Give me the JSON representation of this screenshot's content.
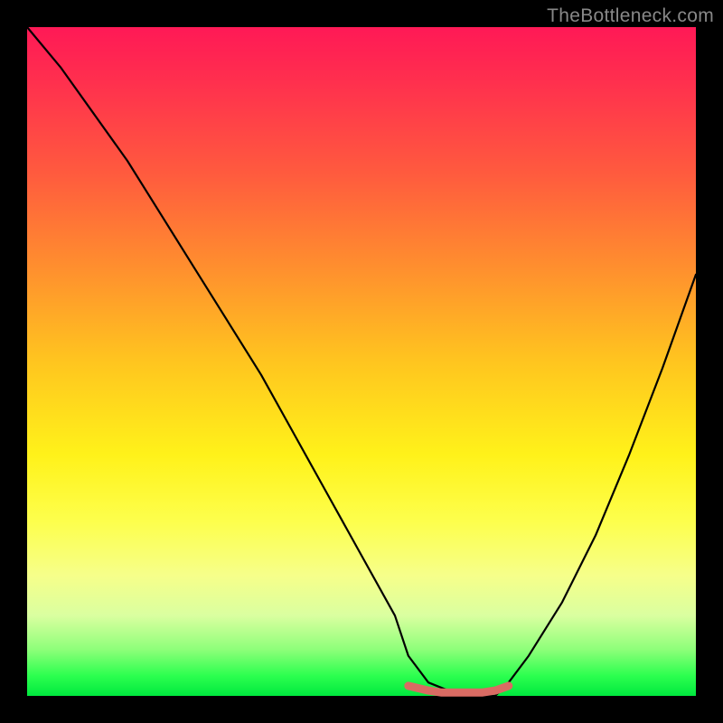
{
  "watermark": "TheBottleneck.com",
  "chart_data": {
    "type": "line",
    "title": "",
    "xlabel": "",
    "ylabel": "",
    "xlim": [
      0,
      100
    ],
    "ylim": [
      0,
      100
    ],
    "grid": false,
    "legend": false,
    "series": [
      {
        "name": "bottleneck-curve",
        "color": "#000000",
        "x": [
          0,
          5,
          10,
          15,
          20,
          25,
          30,
          35,
          40,
          45,
          50,
          55,
          57,
          60,
          65,
          70,
          72,
          75,
          80,
          85,
          90,
          95,
          100
        ],
        "y": [
          100,
          94,
          87,
          80,
          72,
          64,
          56,
          48,
          39,
          30,
          21,
          12,
          6,
          2,
          0,
          0,
          2,
          6,
          14,
          24,
          36,
          49,
          63
        ]
      },
      {
        "name": "optimal-range-marker",
        "color": "#d96b63",
        "x": [
          57,
          60,
          62,
          65,
          68,
          70,
          72
        ],
        "y": [
          1.5,
          0.8,
          0.5,
          0.5,
          0.5,
          0.8,
          1.5
        ]
      }
    ],
    "background_gradient": {
      "stops": [
        {
          "pos": 0.0,
          "color": "#ff1956"
        },
        {
          "pos": 0.22,
          "color": "#ff5b3e"
        },
        {
          "pos": 0.5,
          "color": "#ffc51f"
        },
        {
          "pos": 0.74,
          "color": "#fdff4d"
        },
        {
          "pos": 0.93,
          "color": "#8fff7a"
        },
        {
          "pos": 1.0,
          "color": "#00e83e"
        }
      ]
    }
  }
}
